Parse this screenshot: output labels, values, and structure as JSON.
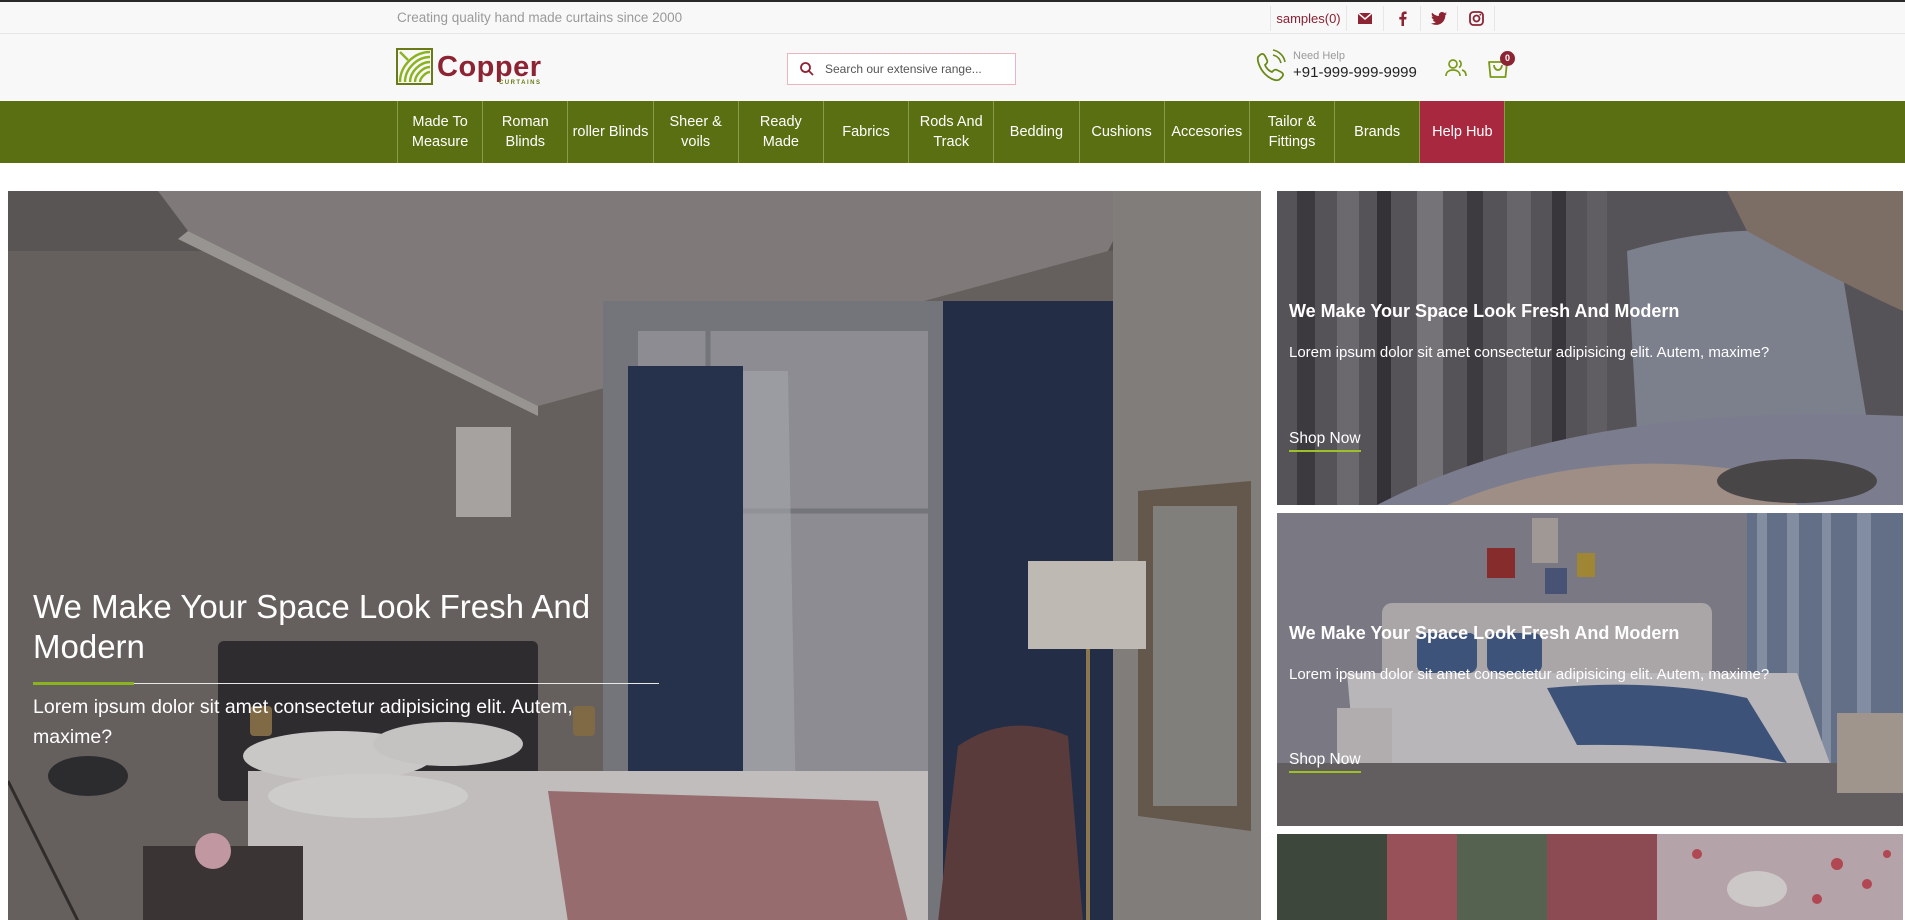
{
  "topbar": {
    "tagline": "Creating quality hand made curtains since 2000",
    "samples_label": "samples(0)",
    "social_icons": [
      "mail-icon",
      "facebook-icon",
      "twitter-icon",
      "instagram-icon"
    ]
  },
  "header": {
    "logo_word": "Copper",
    "logo_sub": "CURTAINS",
    "search_placeholder": "Search our extensive range...",
    "help_label": "Need Help",
    "help_number": "+91-999-999-9999",
    "cart_count": "0"
  },
  "nav": {
    "items": [
      {
        "label": "Made To Measure"
      },
      {
        "label": "Roman Blinds"
      },
      {
        "label": "roller Blinds"
      },
      {
        "label": "Sheer & voils"
      },
      {
        "label": "Ready Made"
      },
      {
        "label": "Fabrics"
      },
      {
        "label": "Rods And Track"
      },
      {
        "label": "Bedding"
      },
      {
        "label": "Cushions"
      },
      {
        "label": "Accesories"
      },
      {
        "label": "Tailor & Fittings"
      },
      {
        "label": "Brands"
      },
      {
        "label": "Help Hub"
      }
    ]
  },
  "hero": {
    "title": "We Make Your Space Look Fresh And Modern",
    "text": "Lorem ipsum dolor sit amet consectetur adipisicing elit. Autem, maxime?"
  },
  "cards": [
    {
      "title": "We Make Your Space Look Fresh And Modern",
      "text": "Lorem ipsum dolor sit amet consectetur adipisicing elit. Autem, maxime?",
      "cta": "Shop Now"
    },
    {
      "title": "We Make Your Space Look Fresh And Modern",
      "text": "Lorem ipsum dolor sit amet consectetur adipisicing elit. Autem, maxime?",
      "cta": "Shop Now"
    }
  ],
  "colors": {
    "brand_maroon": "#8d2434",
    "nav_green": "#5a6f12",
    "accent_green": "#8bb31f",
    "help_hub_red": "#a8283f"
  }
}
